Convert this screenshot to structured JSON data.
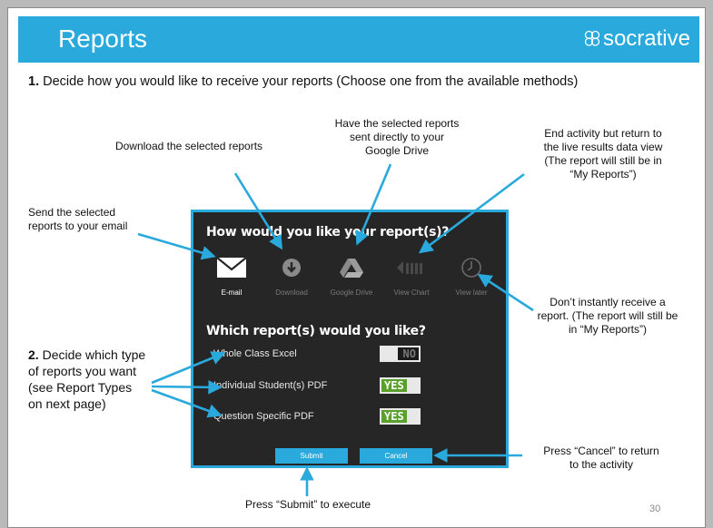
{
  "header": {
    "title": "Reports",
    "brand": "socrative"
  },
  "step1": {
    "number": "1.",
    "text": " Decide how you would like to receive your reports (Choose one from the available methods)"
  },
  "annotations": {
    "email": [
      "Send the selected",
      "reports to your email"
    ],
    "download": [
      "Download the selected reports"
    ],
    "drive": [
      "Have the selected reports",
      "sent directly to your",
      "Google Drive"
    ],
    "end": [
      "End activity but return to",
      "the live results data view",
      "(The report will still be in",
      "“My Reports”)"
    ],
    "later": [
      "Don’t instantly receive a",
      "report. (The report will still be",
      "in “My Reports”)"
    ],
    "cancel": [
      "Press “Cancel” to return",
      "to the activity"
    ],
    "submit": [
      "Press “Submit” to execute"
    ]
  },
  "step2": {
    "number": "2.",
    "lines": [
      " Decide which type",
      "of reports you want",
      "(see Report Types",
      "on next page)"
    ]
  },
  "dialog": {
    "question1": "How would you like your report(s)?",
    "methods": [
      {
        "label": "E-mail",
        "icon": "envelope-icon",
        "active": true
      },
      {
        "label": "Download",
        "icon": "download-icon",
        "active": false
      },
      {
        "label": "Google Drive",
        "icon": "google-drive-icon",
        "active": false
      },
      {
        "label": "View Chart",
        "icon": "chart-icon",
        "active": false
      },
      {
        "label": "View later",
        "icon": "clock-icon",
        "active": false
      }
    ],
    "question2": "Which report(s) would you like?",
    "reports": [
      {
        "label": "Whole Class Excel",
        "toggle": "NO",
        "on": false
      },
      {
        "label": "Individual Student(s) PDF",
        "toggle": "YES",
        "on": true
      },
      {
        "label": "Question Specific PDF",
        "toggle": "YES",
        "on": true
      }
    ],
    "submit_label": "Submit",
    "cancel_label": "Cancel"
  },
  "page_number": "30",
  "colors": {
    "accent": "#29a9dc",
    "dialog_bg": "#262626",
    "toggle_on": "#5aa02c"
  }
}
